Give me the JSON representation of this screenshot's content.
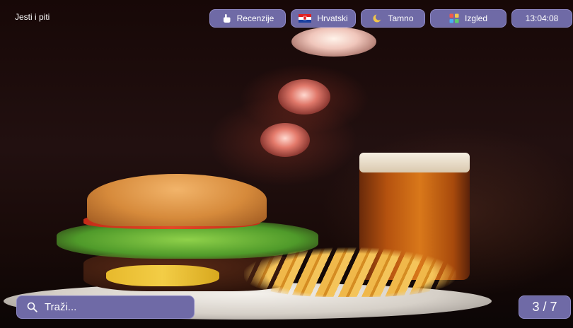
{
  "app": {
    "title": "Jesti i piti"
  },
  "toolbar": {
    "reviews": {
      "label": "Recenzije",
      "icon": "pointing-hand-icon"
    },
    "language": {
      "label": "Hrvatski",
      "icon": "croatian-flag-icon"
    },
    "theme": {
      "label": "Tamno",
      "icon": "moon-icon"
    },
    "layout": {
      "label": "Izgled",
      "icon": "grid-icon"
    },
    "clock": {
      "time": "13:04:08"
    }
  },
  "search": {
    "placeholder": "Traži...",
    "value": "",
    "icon": "search-icon"
  },
  "gallery": {
    "counter": "3 / 7"
  },
  "colors": {
    "pill_bg": "#6f6aa6",
    "pill_border": "#8f8ac6",
    "text": "#ffffff"
  }
}
